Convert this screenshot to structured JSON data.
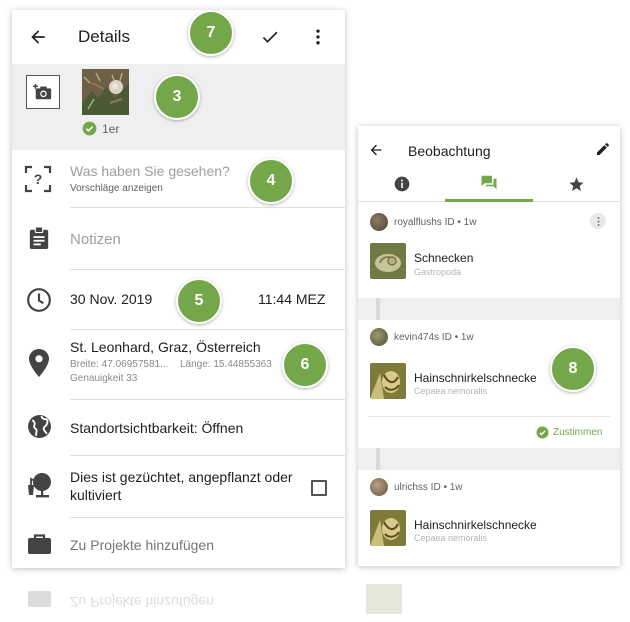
{
  "colors": {
    "accent": "#74a74a",
    "badge": "#74a74a"
  },
  "details": {
    "title": "Details",
    "badge_toolbar": "7",
    "photo_count_label": "1er",
    "badge_photo": "3",
    "what_seen_placeholder": "Was haben Sie gesehen?",
    "suggestions_label": "Vorschläge anzeigen",
    "badge_what": "4",
    "notes_placeholder": "Notizen",
    "date": "30 Nov. 2019",
    "time": "11:44 MEZ",
    "badge_date": "5",
    "location_name": "St. Leonhard, Graz, Österreich",
    "lat_label": "Breite: 47.06957581...",
    "lon_label": "Länge: 15.44855363",
    "accuracy_label": "Genauigkeit 33",
    "badge_location": "6",
    "visibility_label": "Standortsichtbarkeit: Öffnen",
    "captive_label": "Dies ist gezüchtet, angepflanzt oder kultiviert",
    "projects_label": "Zu Projekte hinzufügen"
  },
  "observation": {
    "title": "Beobachtung",
    "tabs": [
      {
        "icon": "info-icon",
        "active": false
      },
      {
        "icon": "chat-icon",
        "active": true
      },
      {
        "icon": "star-icon",
        "active": false
      }
    ],
    "ids": [
      {
        "user": "royalflushs ID • 1w",
        "name": "Schnecken",
        "latin": "Gastropoda"
      },
      {
        "user": "kevin474s ID • 1w",
        "name": "Hainschnirkelschnecke",
        "latin": "Cepaea nemoralis",
        "agree_label": "Zustimmen"
      },
      {
        "user": "ulrichss ID • 1w",
        "name": "Hainschnirkelschnecke",
        "latin": "Cepaea nemoralis"
      }
    ],
    "badge": "8"
  },
  "reflection_text": "Zu Projekte hinzufügen"
}
